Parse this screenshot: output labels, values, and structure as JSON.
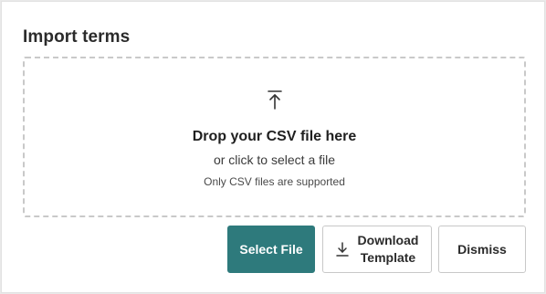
{
  "panel": {
    "title": "Import terms"
  },
  "dropzone": {
    "icon": "upload-arrow-icon",
    "title": "Drop your CSV file here",
    "subtitle": "or click to select a file",
    "note": "Only CSV files are supported"
  },
  "actions": {
    "select_file": "Select File",
    "download_line1": "Download",
    "download_line2": "Template",
    "download_icon": "download-icon",
    "dismiss": "Dismiss"
  },
  "colors": {
    "primary": "#2e7a7c",
    "border_dashed": "#c9c9c9",
    "text": "#2b2b2b"
  }
}
